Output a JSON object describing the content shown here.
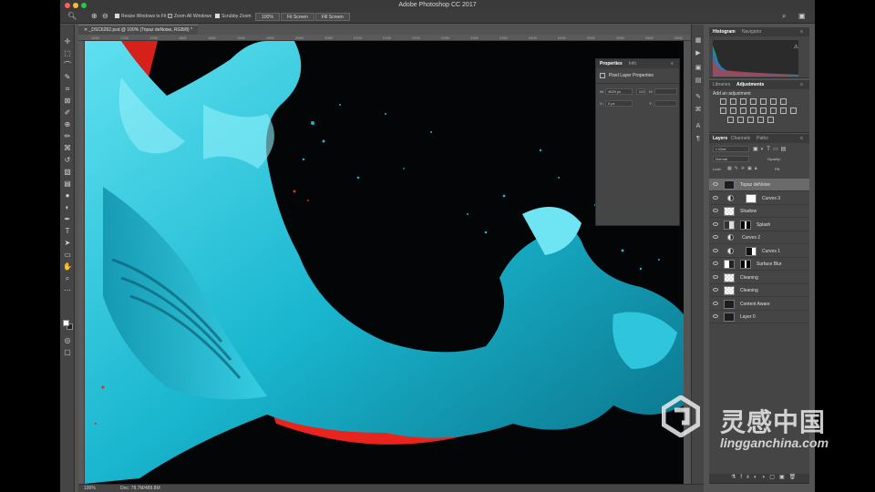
{
  "window": {
    "title": "Adobe Photoshop CC 2017"
  },
  "options_bar": {
    "resize_windows": "Resize Windows to Fit",
    "zoom_all_windows": "Zoom All Windows",
    "scrubby_zoom": "Scrubby Zoom",
    "zoom_100": "100%",
    "fit_screen": "Fit Screen",
    "fill_screen": "Fill Screen"
  },
  "document": {
    "tab_title": "_DSC6262.psd @ 100% (Topaz deNoise, RGB/8) *",
    "ruler_marks": [
      "1650",
      "1700",
      "1750",
      "1800",
      "1850",
      "1900",
      "1950",
      "2000",
      "2050",
      "2100",
      "2150",
      "2200",
      "2250",
      "2300",
      "2350",
      "2400",
      "2450",
      "2500",
      "2550",
      "2600",
      "2650"
    ]
  },
  "status": {
    "zoom": "100%",
    "doc_size": "Doc: 78.7M/489.8M"
  },
  "properties_panel": {
    "tabs": [
      "Properties",
      "Info"
    ],
    "heading": "Pixel Layer Properties",
    "w_label": "W:",
    "w_value": "4629 px",
    "go_label": "GO",
    "h_label": "H:",
    "x_label": "X:",
    "x_value": "0 px",
    "y_label": "Y:"
  },
  "histogram_panel": {
    "tabs": [
      "Histogram",
      "Navigator"
    ]
  },
  "adjustments_panel": {
    "tabs": [
      "Libraries",
      "Adjustments"
    ],
    "hint": "Add an adjustment"
  },
  "layers_panel": {
    "tabs": [
      "Layers",
      "Channels",
      "Paths"
    ],
    "filter_kind": "Kind",
    "blend_mode": "Normal",
    "opacity_label": "Opacity:",
    "lock_label": "Lock:",
    "fill_label": "Fill:",
    "layers": [
      {
        "name": "Topaz deNoise",
        "kind": "pixel",
        "selected": true
      },
      {
        "name": "Curves 3",
        "kind": "adjustment",
        "selected": false
      },
      {
        "name": "Shadow",
        "kind": "checker",
        "selected": false
      },
      {
        "name": "Splash",
        "kind": "masked",
        "selected": false
      },
      {
        "name": "Curves 2",
        "kind": "adjustment-nomask",
        "selected": false
      },
      {
        "name": "Curves 1",
        "kind": "adjustment-dark",
        "selected": false
      },
      {
        "name": "Surface Blur",
        "kind": "masked-white",
        "selected": false
      },
      {
        "name": "Cleaning",
        "kind": "checker",
        "selected": false
      },
      {
        "name": "Cleaning",
        "kind": "checker",
        "selected": false
      },
      {
        "name": "Content Aware",
        "kind": "pixel",
        "selected": false
      },
      {
        "name": "Layer 0",
        "kind": "pixel",
        "selected": false
      }
    ]
  },
  "watermark": {
    "brand_cn": "灵感中国",
    "url": "lingganchina.com"
  },
  "colors": {
    "accent_cyan": "#1bbfd6",
    "paint_red": "#e8241c",
    "ui_dark": "#454545"
  }
}
